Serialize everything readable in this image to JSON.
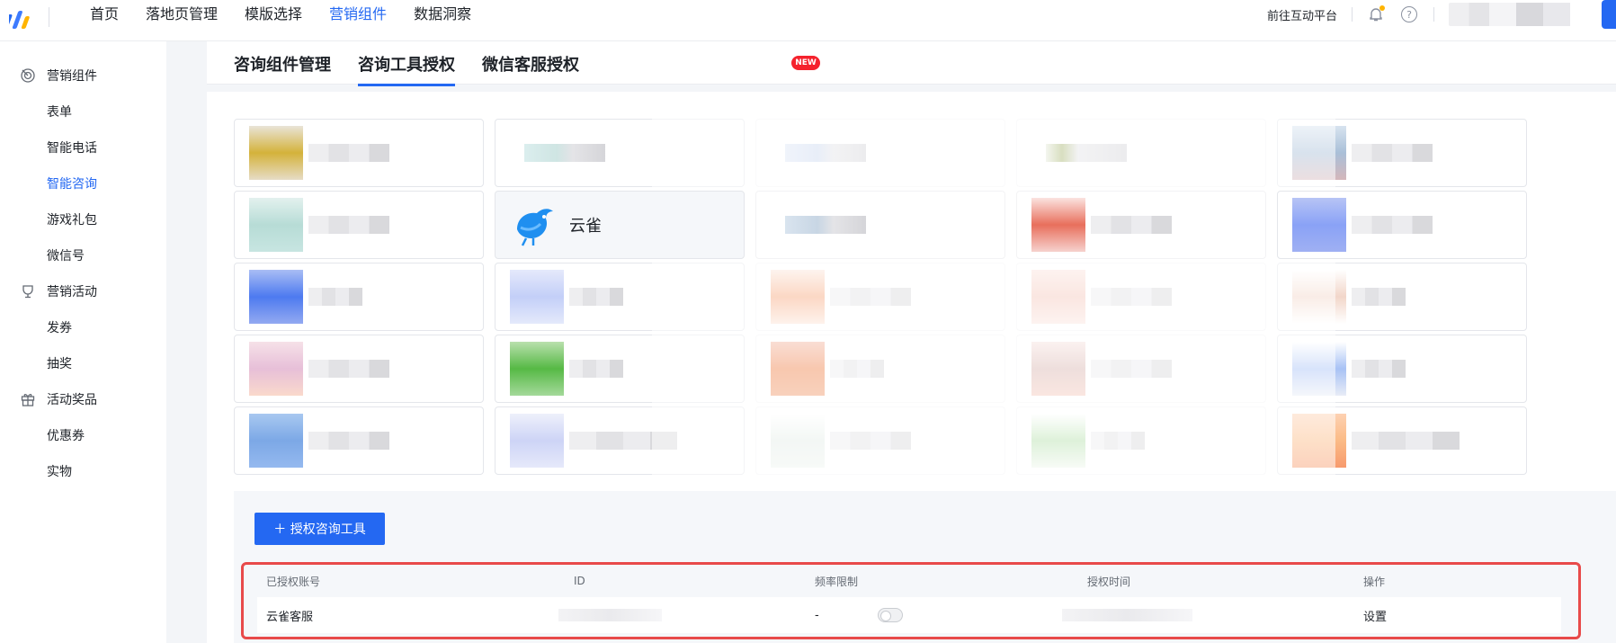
{
  "nav": {
    "items": [
      "首页",
      "落地页管理",
      "模版选择",
      "营销组件",
      "数据洞察"
    ],
    "active_index": 3,
    "goto_label": "前往互动平台",
    "help_glyph": "?"
  },
  "sidebar": {
    "groups": [
      {
        "label": "营销组件",
        "icon": "target-icon",
        "items": [
          "表单",
          "智能电话",
          "智能咨询",
          "游戏礼包",
          "微信号"
        ]
      },
      {
        "label": "营销活动",
        "icon": "trophy-icon",
        "items": [
          "发券",
          "抽奖"
        ]
      },
      {
        "label": "活动奖品",
        "icon": "gift-icon",
        "items": [
          "优惠券",
          "实物"
        ]
      }
    ],
    "active_item": "智能咨询"
  },
  "tabs": {
    "items": [
      "咨询组件管理",
      "咨询工具授权",
      "微信客服授权"
    ],
    "active_index": 1,
    "new_badge": "NEW"
  },
  "tools": {
    "featured_name": "云雀"
  },
  "actions": {
    "add_label": "＋ 授权咨询工具"
  },
  "table": {
    "headers": [
      "已授权账号",
      "ID",
      "频率限制",
      "授权时间",
      "操作"
    ],
    "rows": [
      {
        "account": "云雀客服",
        "rate_limit": "-",
        "action": "设置"
      }
    ]
  },
  "colors": {
    "accent": "#2468f2",
    "highlight_border": "#e84a4a",
    "badge": "#f5222d"
  }
}
